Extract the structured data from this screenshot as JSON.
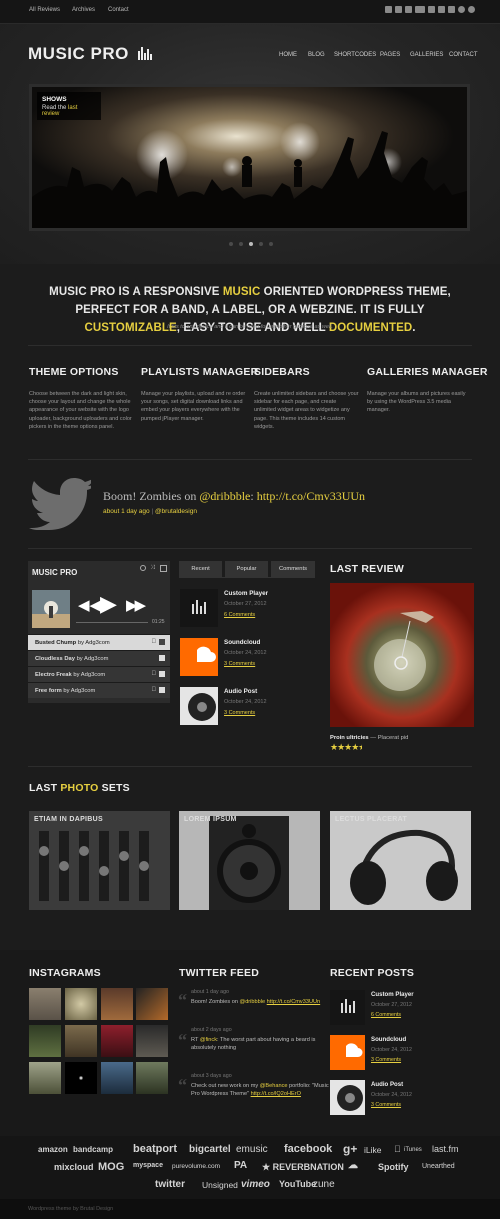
{
  "topbar": {
    "links": [
      "All Reviews",
      "Archives",
      "Contact"
    ]
  },
  "header": {
    "logo": "MUSIC PRO",
    "nav": [
      "HOME",
      "BLOG",
      "SHORTCODES",
      "PAGES",
      "GALLERIES",
      "CONTACT"
    ]
  },
  "slider": {
    "title": "SHOWS",
    "text_prefix": "Read the",
    "link": "last review"
  },
  "intro": {
    "p1": "MUSIC PRO IS A RESPONSIVE ",
    "h1": "MUSIC",
    "p2": " ORIENTED WORDPRESS THEME, PERFECT FOR A BAND, A LABEL, OR A WEBZINE. IT IS FULLY ",
    "h2": "CUSTOMIZABLE",
    "p3": ", EASY TO USE AND WELL ",
    "h3": "DOCUMENTED",
    "p4": ".",
    "sub": "It fits to any device and it can be used for any other purpose as well."
  },
  "features": [
    {
      "title": "THEME OPTIONS",
      "text": "Choose between the dark and light skin, choose your layout and change the whole appearance of your website with the logo uploader, background uploaders and color pickers in the theme options panel."
    },
    {
      "title": "PLAYLISTS MANAGER",
      "text": "Manage your playlists, upload and re order your songs, set digital download links and embed your players everywhere with the pumped jPlayer manager."
    },
    {
      "title": "SIDEBARS",
      "text": "Create unlimited sidebars and choose your sidebar for each page, and create unlimited widget areas to widgetize any page. This theme includes 14 custom widgets."
    },
    {
      "title": "GALLERIES MANAGER",
      "text": "Manage your albums and pictures easily by using the WordPress 3.5 media manager."
    }
  ],
  "tweet": {
    "text_prefix": "Boom! Zombies on ",
    "handle": "@dribbble",
    "sep": ": ",
    "link": "http://t.co/Cmv33UUn",
    "time": "about 1 day ago",
    "user": "@brutaldesign"
  },
  "player": {
    "logo": "MUSIC PRO",
    "time_total": "01:25",
    "tracks": [
      {
        "title": "Busted Chump",
        "by": "by Adg3com"
      },
      {
        "title": "Cloudless Day",
        "by": "by Adg3com"
      },
      {
        "title": "Electro Freak",
        "by": "by Adg3com"
      },
      {
        "title": "Free form",
        "by": "by Adg3com"
      }
    ]
  },
  "posts_tabs": [
    "Recent",
    "Popular",
    "Comments"
  ],
  "posts": [
    {
      "title": "Custom Player",
      "date": "October 27, 2012",
      "comments": "6 Comments"
    },
    {
      "title": "Soundcloud",
      "date": "October 24, 2012",
      "comments": "3 Comments"
    },
    {
      "title": "Audio Post",
      "date": "October 24, 2012",
      "comments": "3 Comments"
    }
  ],
  "last_review": {
    "heading": "LAST REVIEW",
    "title": "Proin ultricies",
    "subtitle": " — Placerat pid",
    "rating": 4.5
  },
  "photo_sets": {
    "heading_a": "LAST ",
    "heading_b": "PHOTO",
    "heading_c": " SETS",
    "items": [
      "ETIAM IN DAPIBUS",
      "LOREM IPSUM",
      "LECTUS PLACERAT"
    ]
  },
  "instagrams": {
    "heading": "INSTAGRAMS"
  },
  "twitter_feed": {
    "heading": "TWITTER FEED",
    "items": [
      {
        "date": "about 1 day ago",
        "pre": "Boom! Zombies on ",
        "h": "@dribbble",
        "post": "",
        "link": "http://t.co/Cmv33UUn"
      },
      {
        "date": "about 2 days ago",
        "pre": "RT ",
        "h": "@finck",
        "post": ": The worst part about having a beard is absolutely nothing",
        "link": ""
      },
      {
        "date": "about 3 days ago",
        "pre": "Check out new work on my ",
        "h": "@Behance",
        "post": " portfolio: \"Music Pro Wordpress Theme\" ",
        "link": "http://t.co/lQ2oHErO"
      }
    ]
  },
  "recent_posts": {
    "heading": "RECENT POSTS",
    "items": [
      {
        "title": "Custom Player",
        "date": "October 27, 2012",
        "comments": "6 Comments"
      },
      {
        "title": "Soundcloud",
        "date": "October 24, 2012",
        "comments": "3 Comments"
      },
      {
        "title": "Audio Post",
        "date": "October 24, 2012",
        "comments": "3 Comments"
      }
    ]
  },
  "brands": [
    "amazon",
    "bandcamp",
    "beatport",
    "bigcartel",
    "emusic",
    "facebook",
    "iLike",
    "iTunes",
    "last.fm",
    "mixcloud",
    "MOG",
    "myspace",
    "purevolume.com",
    "REVERBNATION",
    "Spotify",
    "Unearthed",
    "twitter",
    "Unsigned",
    "vimeo",
    "YouTube",
    "zune"
  ],
  "footer": "Wordpress theme by Brutal Design"
}
